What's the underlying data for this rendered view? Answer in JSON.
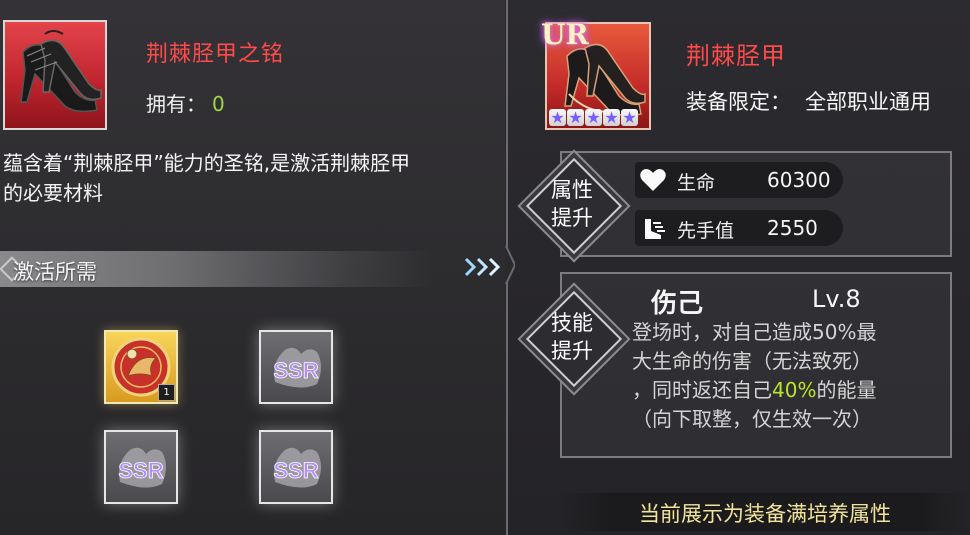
{
  "left": {
    "item_name": "荆棘胫甲之铭",
    "own_label": "拥有：",
    "own_value": "0",
    "description": "蕴含着“荆棘胫甲”能力的圣铭,是激活荆棘胫甲的必要材料",
    "requirement_header": "激活所需",
    "materials": [
      {
        "icon": "emblem-icon",
        "count": "1"
      },
      {
        "icon": "ssr-icon",
        "label": "SSR"
      },
      {
        "icon": "ssr-icon",
        "label": "SSR"
      },
      {
        "icon": "ssr-icon",
        "label": "SSR"
      }
    ]
  },
  "right": {
    "rarity": "UR",
    "star_count": 5,
    "equip_name": "荆棘胫甲",
    "limit_label": "装备限定：",
    "limit_value": "全部职业通用",
    "attr_section": "属性提升",
    "attr_section_lines": [
      "属性",
      "提升"
    ],
    "stats": [
      {
        "icon": "heart-icon",
        "name": "生命",
        "value": "60300"
      },
      {
        "icon": "boot-speed-icon",
        "name": "先手值",
        "value": "2550"
      }
    ],
    "skill_section_lines": [
      "技能",
      "提升"
    ],
    "skill": {
      "name": "伤己",
      "level": "Lv.8",
      "desc_lines": [
        "登场时，对自己造成50%最",
        "大生命的伤害（无法致死）",
        "，同时返还自己",
        "40%",
        "的能量",
        "（向下取整，仅生效一次）"
      ]
    },
    "footer_note": "当前展示为装备满培养属性"
  },
  "colors": {
    "name_red": "#ff4a4a",
    "own_green": "#9dd64a",
    "highlight_green": "#b8e62a",
    "note_yellow": "#f2e49a"
  }
}
